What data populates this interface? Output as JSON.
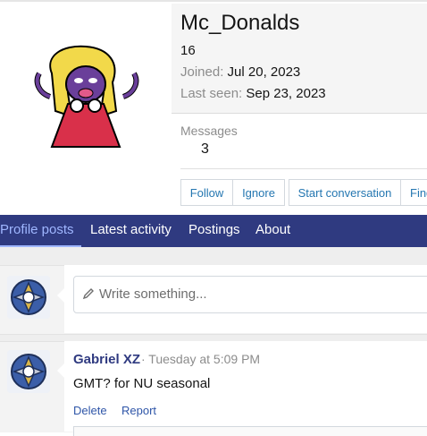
{
  "profile": {
    "username": "Mc_Donalds",
    "age": "16",
    "joined_label": "Joined:",
    "joined_value": "Jul 20, 2023",
    "seen_label": "Last seen:",
    "seen_value": "Sep 23, 2023",
    "messages_label": "Messages",
    "messages_value": "3"
  },
  "actions": {
    "follow": "Follow",
    "ignore": "Ignore",
    "start_conversation": "Start conversation",
    "find": "Find"
  },
  "tabs": [
    {
      "label": "Profile posts",
      "active": true
    },
    {
      "label": "Latest activity",
      "active": false
    },
    {
      "label": "Postings",
      "active": false
    },
    {
      "label": "About",
      "active": false
    }
  ],
  "composer": {
    "placeholder": "Write something..."
  },
  "post": {
    "author": "Gabriel XZ",
    "time": "· Tuesday at 5:09 PM",
    "text": "GMT? for NU seasonal",
    "delete": "Delete",
    "report": "Report"
  },
  "colors": {
    "nav": "#2f3a80",
    "link": "#2577b1",
    "active_tab": "#9fb6ff"
  }
}
